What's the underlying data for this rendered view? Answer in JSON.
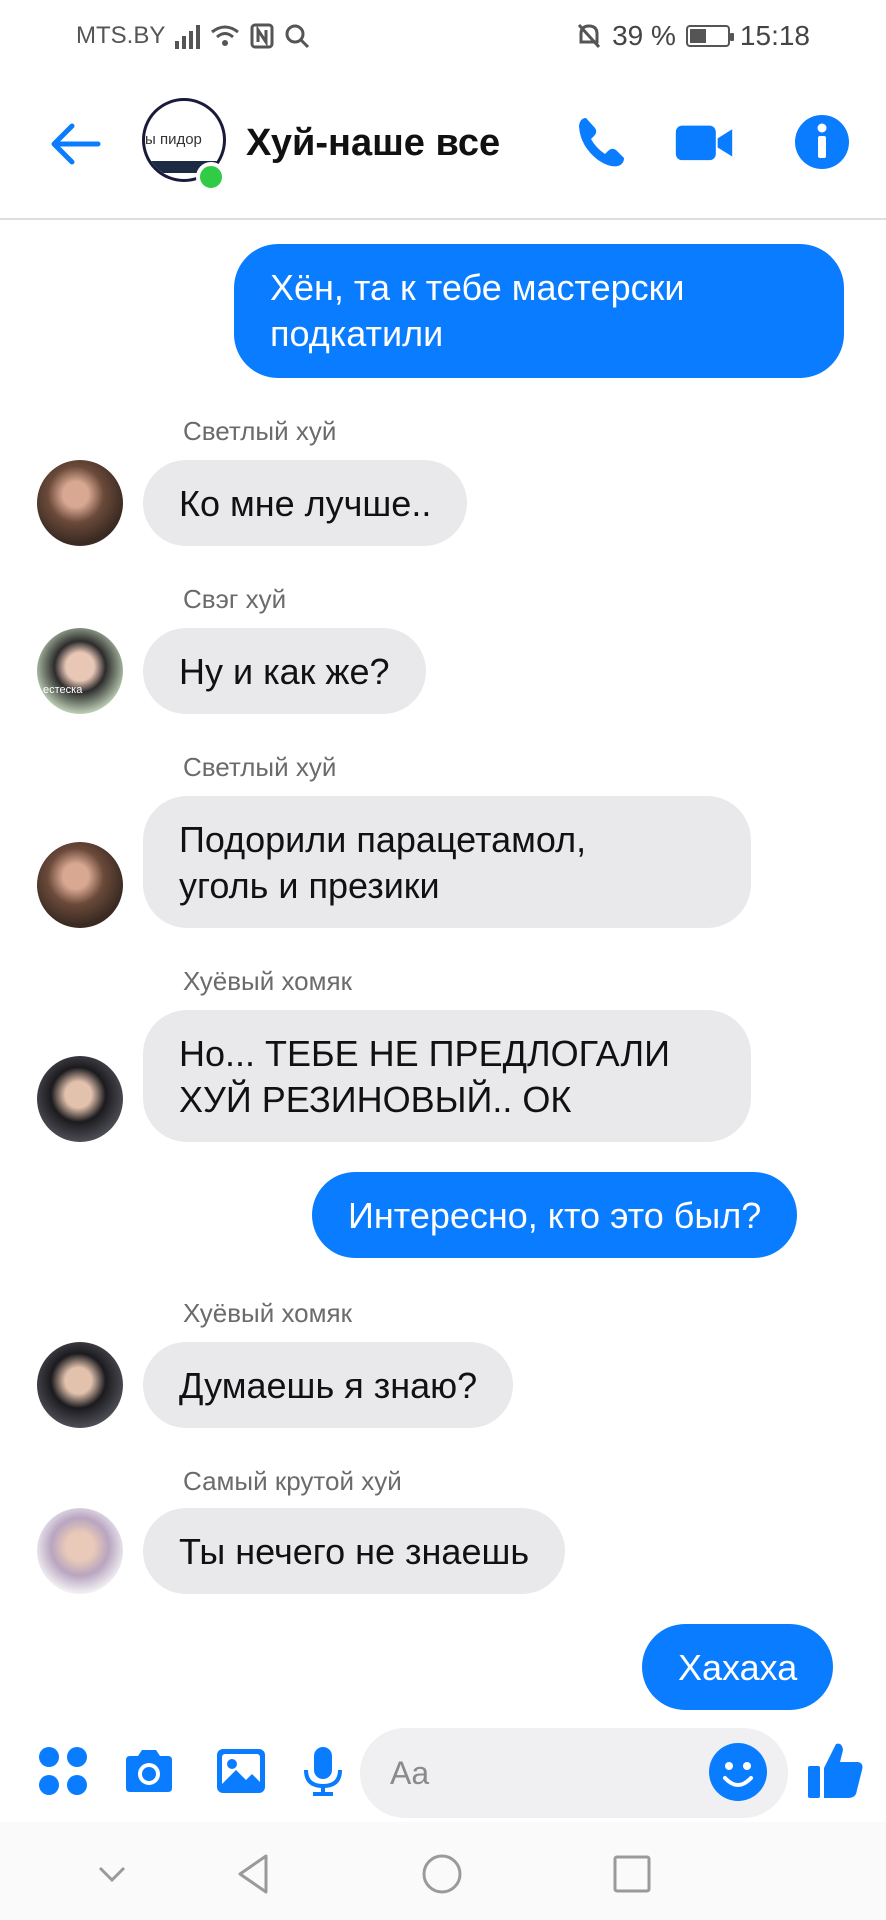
{
  "status": {
    "carrier": "MTS.BY",
    "battery": "39 %",
    "time": "15:18"
  },
  "header": {
    "group_avatar_text": "ы пидор",
    "title": "Хуй-наше все"
  },
  "messages": [
    {
      "dir": "out",
      "text_lines": [
        "Хён, та к тебе мастерски",
        "подкатили"
      ]
    },
    {
      "dir": "in",
      "sender": "Светлый хуй",
      "text_lines": [
        "Ко мне лучше.."
      ]
    },
    {
      "dir": "in",
      "sender": "Свэг хуй",
      "text_lines": [
        "Ну и как же?"
      ],
      "avatar_caption": "естеска"
    },
    {
      "dir": "in",
      "sender": "Светлый хуй",
      "text_lines": [
        "Подорили парацетамол,",
        "уголь и презики"
      ]
    },
    {
      "dir": "in",
      "sender": "Хуёвый хомяк",
      "text_lines": [
        "Но... ТЕБЕ НЕ ПРЕДЛОГАЛИ",
        "ХУЙ РЕЗИНОВЫЙ.. ОК"
      ]
    },
    {
      "dir": "out",
      "text_lines": [
        "Интересно, кто это был?"
      ]
    },
    {
      "dir": "in",
      "sender": "Хуёвый хомяк",
      "text_lines": [
        "Думаешь я знаю?"
      ]
    },
    {
      "dir": "in",
      "sender": "Самый крутой хуй",
      "text_lines": [
        "Ты нечего не знаешь"
      ]
    },
    {
      "dir": "out",
      "text_lines": [
        "Хахаха"
      ]
    }
  ],
  "composer": {
    "placeholder": "Aa"
  },
  "colors": {
    "accent": "#0a7cff",
    "incoming_bubble": "#e9e9ec",
    "online": "#31cc46"
  },
  "icons": [
    "back-arrow-icon",
    "phone-icon",
    "video-camera-icon",
    "info-icon",
    "apps-icon",
    "camera-icon",
    "gallery-icon",
    "microphone-icon",
    "emoji-icon",
    "thumbs-up-icon"
  ]
}
